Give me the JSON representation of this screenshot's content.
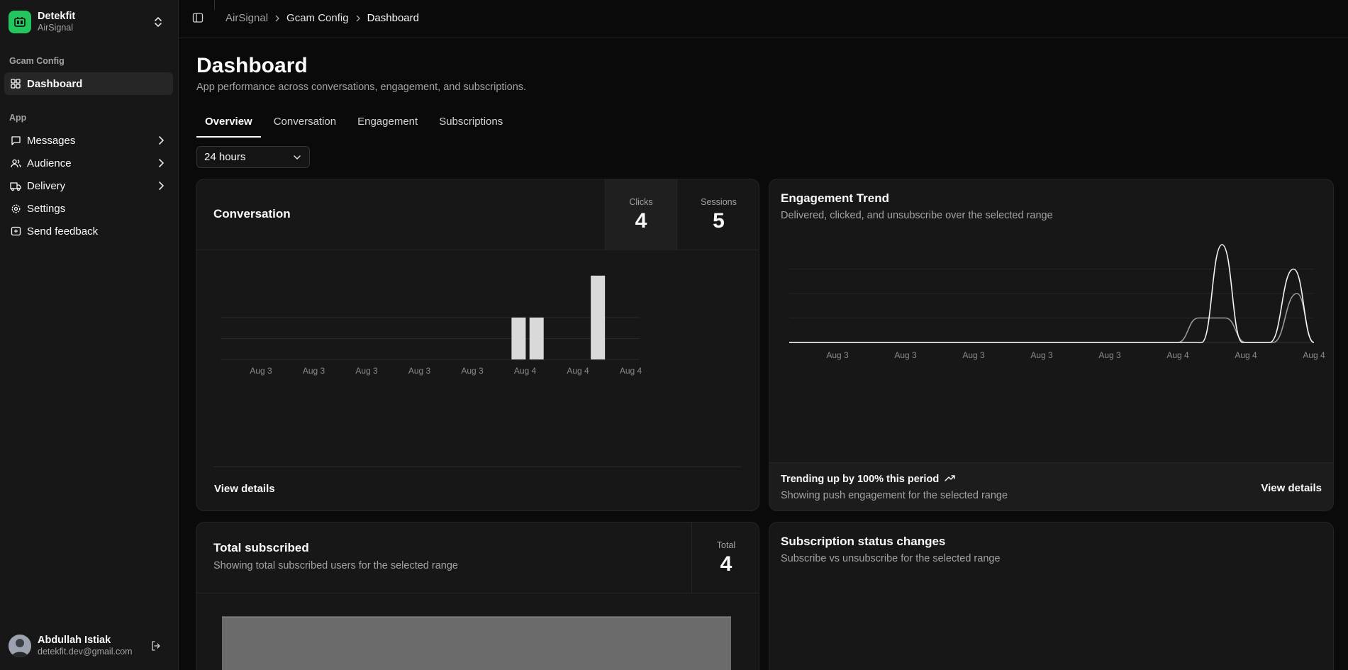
{
  "sidebar": {
    "brand": {
      "name": "Detekfit",
      "sub": "AirSignal"
    },
    "group1": "Gcam Config",
    "dashboard": "Dashboard",
    "group2": "App",
    "items": [
      {
        "label": "Messages",
        "icon": "message-square-icon"
      },
      {
        "label": "Audience",
        "icon": "users-icon"
      },
      {
        "label": "Delivery",
        "icon": "truck-icon"
      },
      {
        "label": "Settings",
        "icon": "gear-icon"
      },
      {
        "label": "Send feedback",
        "icon": "feedback-icon"
      }
    ],
    "user": {
      "name": "Abdullah Istiak",
      "email": "detekfit.dev@gmail.com"
    }
  },
  "header": {
    "breadcrumb": [
      "AirSignal",
      "Gcam Config",
      "Dashboard"
    ]
  },
  "page": {
    "title": "Dashboard",
    "subtitle": "App performance across conversations, engagement, and subscriptions.",
    "tabs": [
      "Overview",
      "Conversation",
      "Engagement",
      "Subscriptions"
    ],
    "range": "24 hours"
  },
  "conversation": {
    "title": "Conversation",
    "stats": [
      {
        "label": "Clicks",
        "value": "4"
      },
      {
        "label": "Sessions",
        "value": "5"
      }
    ],
    "view_details": "View details"
  },
  "engagement": {
    "title": "Engagement Trend",
    "desc": "Delivered, clicked, and unsubscribe over the selected range",
    "trend": "Trending up by 100% this period",
    "foot_desc": "Showing push engagement for the selected range",
    "view_details": "View details"
  },
  "subscribed": {
    "title": "Total subscribed",
    "desc": "Showing total subscribed users for the selected range",
    "stat_label": "Total",
    "stat_value": "4"
  },
  "status_changes": {
    "title": "Subscription status changes",
    "desc": "Subscribe vs unsubscribe for the selected range"
  },
  "colors": {
    "accent": "#22c55e",
    "bar": "#d9d9d9",
    "bg": "#0a0a0a",
    "card": "#171717"
  },
  "chart_data": [
    {
      "type": "bar",
      "categories": [
        "Aug 3",
        "Aug 3",
        "Aug 3",
        "Aug 3",
        "Aug 3",
        "Aug 4",
        "Aug 4",
        "Aug 4"
      ],
      "x_positions": [
        0,
        1,
        2,
        3,
        4,
        5,
        6,
        7
      ],
      "bars": [
        {
          "x": 5.2,
          "value": 2
        },
        {
          "x": 5.54,
          "value": 2
        },
        {
          "x": 6.7,
          "value": 4
        }
      ],
      "ylim": [
        0,
        4.5
      ],
      "grid": true
    },
    {
      "type": "line",
      "categories": [
        "Aug 3",
        "Aug 3",
        "Aug 3",
        "Aug 3",
        "Aug 3",
        "Aug 4",
        "Aug 4",
        "Aug 4"
      ],
      "series": [
        {
          "points": [
            [
              0,
              0
            ],
            [
              5,
              0
            ],
            [
              5.3,
              1
            ],
            [
              5.7,
              1
            ],
            [
              6.0,
              0
            ],
            [
              6.4,
              0
            ],
            [
              6.75,
              2
            ],
            [
              7,
              0
            ]
          ]
        },
        {
          "points": [
            [
              0,
              0
            ],
            [
              5,
              0
            ],
            [
              5.35,
              0
            ],
            [
              5.65,
              4
            ],
            [
              5.95,
              0
            ],
            [
              6.35,
              0
            ],
            [
              6.7,
              3
            ],
            [
              7,
              0
            ]
          ]
        }
      ],
      "ylim": [
        0,
        4
      ],
      "grid": true
    },
    {
      "type": "area",
      "categories": [],
      "values": [
        4
      ],
      "ylim": [
        0,
        4
      ]
    }
  ]
}
